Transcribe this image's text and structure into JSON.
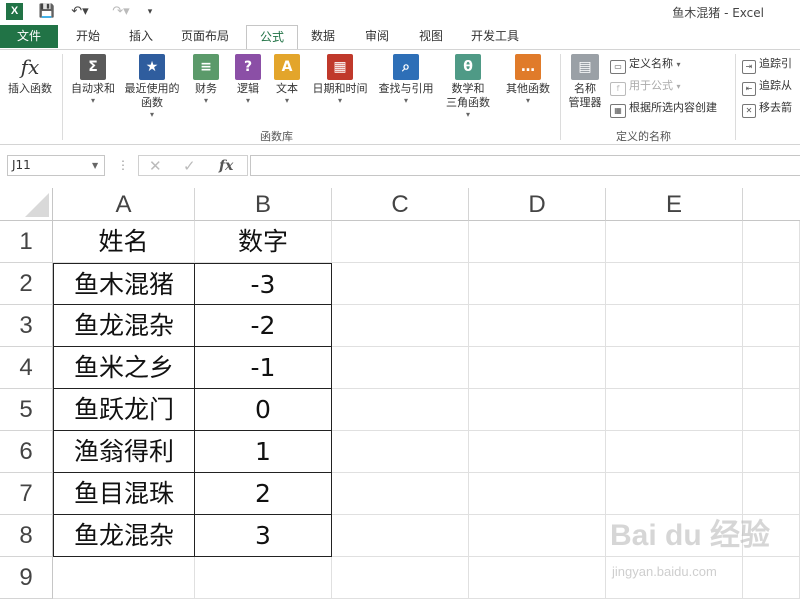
{
  "window": {
    "title": "鱼木混猪 - Excel"
  },
  "tabs": [
    "文件",
    "开始",
    "插入",
    "页面布局",
    "公式",
    "数据",
    "审阅",
    "视图",
    "开发工具"
  ],
  "ribbon": {
    "insert_function": "插入函数",
    "library": [
      {
        "label1": "自动求和",
        "label2": "",
        "icon": "sum-icon",
        "glyph": "Σ",
        "color": "#5a5a5a"
      },
      {
        "label1": "最近使用的",
        "label2": "函数",
        "icon": "star-book-icon",
        "glyph": "★",
        "color": "#2f5d9e"
      },
      {
        "label1": "财务",
        "label2": "",
        "icon": "coins-icon",
        "glyph": "≡",
        "color": "#5b9a6a"
      },
      {
        "label1": "逻辑",
        "label2": "",
        "icon": "question-book-icon",
        "glyph": "?",
        "color": "#8b4fa6"
      },
      {
        "label1": "文本",
        "label2": "",
        "icon": "text-book-icon",
        "glyph": "A",
        "color": "#e3a52b"
      },
      {
        "label1": "日期和时间",
        "label2": "",
        "icon": "calendar-icon",
        "glyph": "▦",
        "color": "#c0392b"
      },
      {
        "label1": "查找与引用",
        "label2": "",
        "icon": "magnifier-book-icon",
        "glyph": "⌕",
        "color": "#2e6fb7"
      },
      {
        "label1": "数学和",
        "label2": "三角函数",
        "icon": "theta-book-icon",
        "glyph": "θ",
        "color": "#4f9a86"
      },
      {
        "label1": "其他函数",
        "label2": "",
        "icon": "more-book-icon",
        "glyph": "…",
        "color": "#e07b2a"
      }
    ],
    "library_group": "函数库",
    "name_manager_1": "名称",
    "name_manager_2": "管理器",
    "define_name": "定义名称",
    "use_in_formula": "用于公式",
    "create_from_selection": "根据所选内容创建",
    "names_group": "定义的名称",
    "trace_precedents": "追踪引",
    "trace_dependents": "追踪从",
    "remove_arrows": "移去箭"
  },
  "formula_bar": {
    "name_box": "J11",
    "fx": "fx",
    "content": ""
  },
  "columns": [
    "A",
    "B",
    "C",
    "D",
    "E"
  ],
  "rows": [
    "1",
    "2",
    "3",
    "4",
    "5",
    "6",
    "7",
    "8",
    "9"
  ],
  "table": {
    "headers": [
      "姓名",
      "数字"
    ],
    "rows": [
      [
        "鱼木混猪",
        "-3"
      ],
      [
        "鱼龙混杂",
        "-2"
      ],
      [
        "鱼米之乡",
        "-1"
      ],
      [
        "鱼跃龙门",
        "0"
      ],
      [
        "渔翁得利",
        "1"
      ],
      [
        "鱼目混珠",
        "2"
      ],
      [
        "鱼龙混杂",
        "3"
      ]
    ]
  },
  "watermark": {
    "main": "Bai du 经验",
    "sub": "jingyan.baidu.com"
  },
  "colors": {
    "excel_green": "#217346"
  }
}
